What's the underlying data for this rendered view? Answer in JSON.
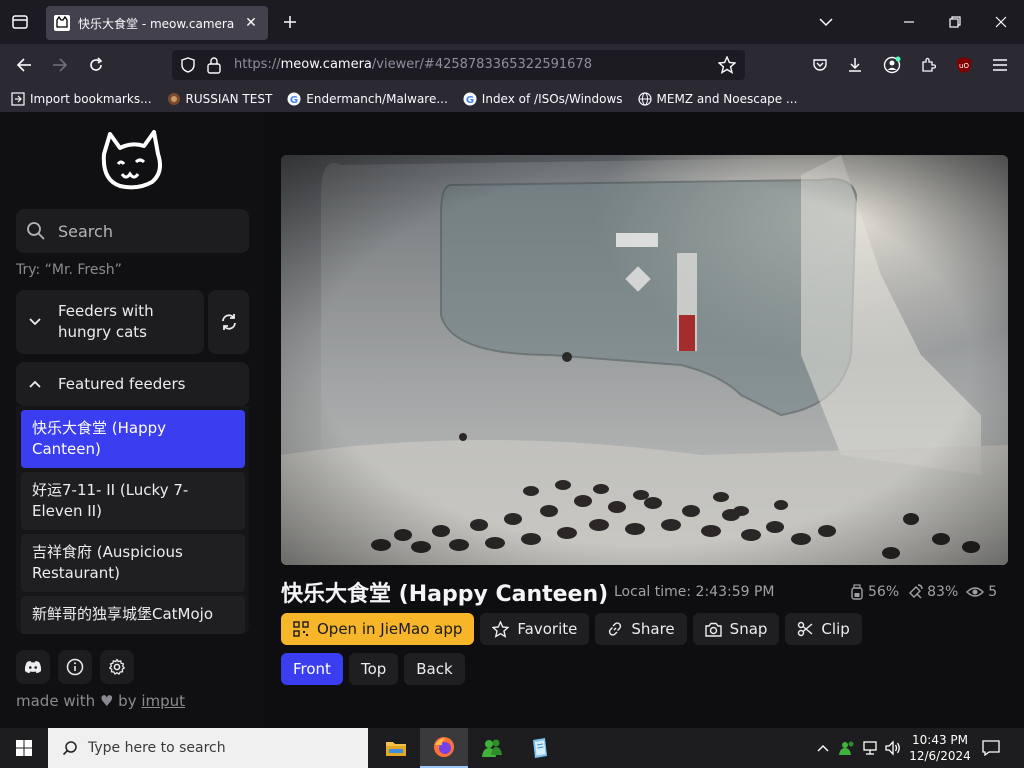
{
  "browser": {
    "tab_title": "快乐大食堂 - meow.camera",
    "url_prefix": "https://",
    "url_host": "meow.camera",
    "url_path": "/viewer/#4258783365322591678",
    "bookmarks": [
      {
        "label": "Import bookmarks...",
        "icon": "import-icon"
      },
      {
        "label": "RUSSIAN TEST",
        "icon": "site-icon"
      },
      {
        "label": "Endermanch/Malware...",
        "icon": "google-icon"
      },
      {
        "label": "Index of /ISOs/Windows",
        "icon": "google-icon"
      },
      {
        "label": "MEMZ and Noescape ...",
        "icon": "globe-icon"
      }
    ],
    "extension_badge": "uO"
  },
  "sidebar": {
    "search_placeholder": "Search",
    "try_hint": "Try: “Mr. Fresh”",
    "hungry_label": "Feeders with hungry cats",
    "featured_label": "Featured feeders",
    "feeders": [
      {
        "label": "快乐大食堂 (Happy Canteen)",
        "active": true
      },
      {
        "label": "好运7-11- II  (Lucky 7-Eleven II)",
        "active": false
      },
      {
        "label": "吉祥食府 (Auspicious Restaurant)",
        "active": false
      },
      {
        "label": "新鲜哥的独享城堡CatMojo",
        "active": false
      }
    ],
    "made_with_prefix": "made with",
    "made_with_by": "by",
    "made_with_link": "imput"
  },
  "camera": {
    "title": "快乐大食堂 (Happy Canteen)",
    "local_time": "Local time: 2:43:59 PM",
    "food_level": "56%",
    "signal_level": "83%",
    "viewers": "5",
    "actions": {
      "open_app": "Open in JieMao app",
      "favorite": "Favorite",
      "share": "Share",
      "snap": "Snap",
      "clip": "Clip"
    },
    "views": [
      "Front",
      "Top",
      "Back"
    ],
    "active_view": "Front"
  },
  "taskbar": {
    "search_placeholder": "Type here to search",
    "time": "10:43 PM",
    "date": "12/6/2024"
  },
  "colors": {
    "accent_blue": "#3b3ef0",
    "accent_yellow": "#f7b52a"
  }
}
